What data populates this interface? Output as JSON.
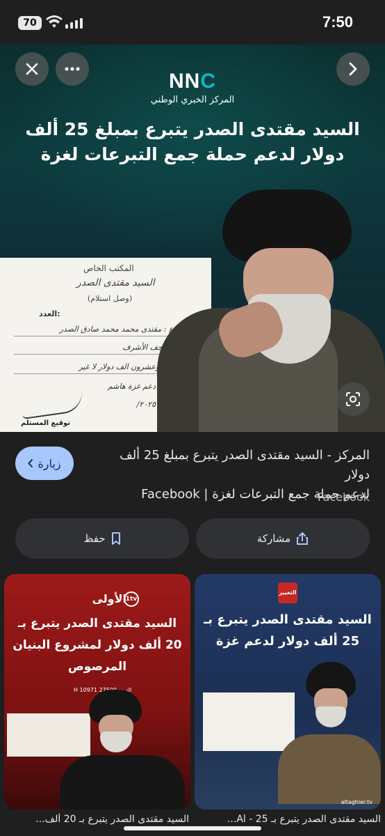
{
  "status_bar": {
    "battery": "70",
    "time": "7:50"
  },
  "hero": {
    "brand_logo": "NNC",
    "brand_subtitle": "المركز الخبري الوطني",
    "headline": "السيد مقتدى الصدر يتبرع بمبلغ 25 ألف دولار لدعم حملة جمع التبرعات لغزة",
    "document": {
      "header_line1": "المكتب الخاص",
      "header_line2": "السيد مقتدى الصدر",
      "header_line3": "(وصل استلام)",
      "number_label": "العدد:",
      "donor_line": "اسم المتبرع : مقتدى محمد محمد صادق الصدر",
      "province_line": "المحافظة : النجف الأشرف",
      "amount_line": "المبلغ : خمسة وعشرون الف دولار لا غير",
      "purpose_line": "دعم غزة هاشم",
      "date_line": "٢٠٢٥/",
      "signature_label": "توقيع المستلم"
    },
    "buttons": {
      "close_icon": "close-icon",
      "more_icon": "more-icon",
      "next_icon": "chevron-right-icon",
      "lens_icon": "lens-icon"
    }
  },
  "result": {
    "title_line1": "المركز - السيد مقتدى الصدر يتبرع بمبلغ 25 ألف دولار",
    "title_line2": "لدعم حملة جمع التبرعات لغزة | Facebook",
    "source": "Facebook",
    "visit_label": "زيارة"
  },
  "actions": {
    "save_label": "حفظ",
    "share_label": "مشاركة"
  },
  "related": [
    {
      "brand": "الأولى",
      "brand_badge": "1tv",
      "title": "السيد مقتدى الصدر يتبرع بـ 20 ألف دولار لمشروع البنيان المرصوص",
      "frequency": "التردد 27500 H 10971",
      "caption": "السيد مقتدى الصدر يتبرع بـ 20 ألف..."
    },
    {
      "brand": "التغيير",
      "title": "السيد مقتدى الصدر يتبرع بـ 25 ألف دولار لدعم غزة",
      "website": "altaghier.tv",
      "caption": "السيد مقتدى الصدر يتبرع بـ 25 - Al..."
    }
  ],
  "colors": {
    "background": "#1f1f1f",
    "visit_button": "#a8c7fa",
    "action_button": "#303134",
    "brand_accent": "#13b5c6"
  }
}
